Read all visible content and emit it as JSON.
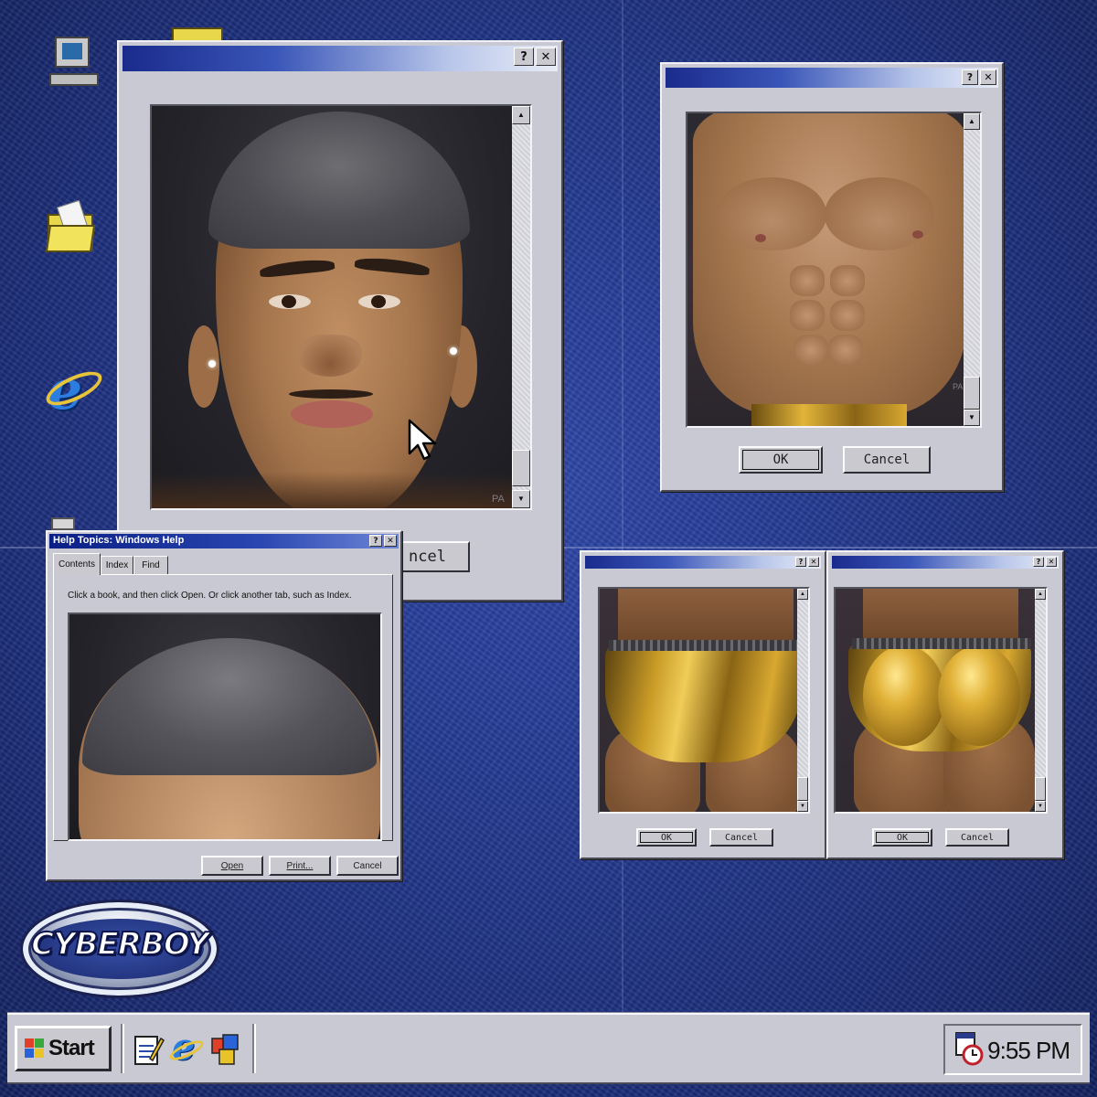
{
  "theme": {
    "desktop_color": "#243a92",
    "titlebar_color": "#1a2b8c",
    "window_gray": "#c8c9d2",
    "gold_accent": "#d8a830"
  },
  "desktop_icons": [
    {
      "name": "computer-icon"
    },
    {
      "name": "folder-icon"
    },
    {
      "name": "internet-explorer-icon"
    }
  ],
  "windows": {
    "face": {
      "title": "",
      "buttons": [
        "?",
        "✕"
      ],
      "action_partial": "ncel",
      "watermark": "PA"
    },
    "torso": {
      "title": "",
      "buttons": [
        "?",
        "✕"
      ],
      "ok_label": "OK",
      "cancel_label": "Cancel",
      "watermark": "PA"
    },
    "front": {
      "buttons": [
        "?",
        "✕"
      ],
      "ok_label": "OK",
      "cancel_label": "Cancel"
    },
    "back": {
      "buttons": [
        "?",
        "✕"
      ],
      "ok_label": "OK",
      "cancel_label": "Cancel"
    }
  },
  "help_dialog": {
    "title": "Help Topics: Windows Help",
    "buttons": [
      "?",
      "✕"
    ],
    "tabs": [
      "Contents",
      "Index",
      "Find"
    ],
    "instruction": "Click a book, and then click Open. Or click another tab, such as Index.",
    "open_label": "Open",
    "print_label": "Print...",
    "cancel_label": "Cancel"
  },
  "logo": {
    "text": "CYBERBOY"
  },
  "taskbar": {
    "start_label": "Start",
    "quick_launch": [
      "notepad-icon",
      "internet-explorer-icon",
      "channels-icon"
    ],
    "clock": "9:55 PM"
  }
}
